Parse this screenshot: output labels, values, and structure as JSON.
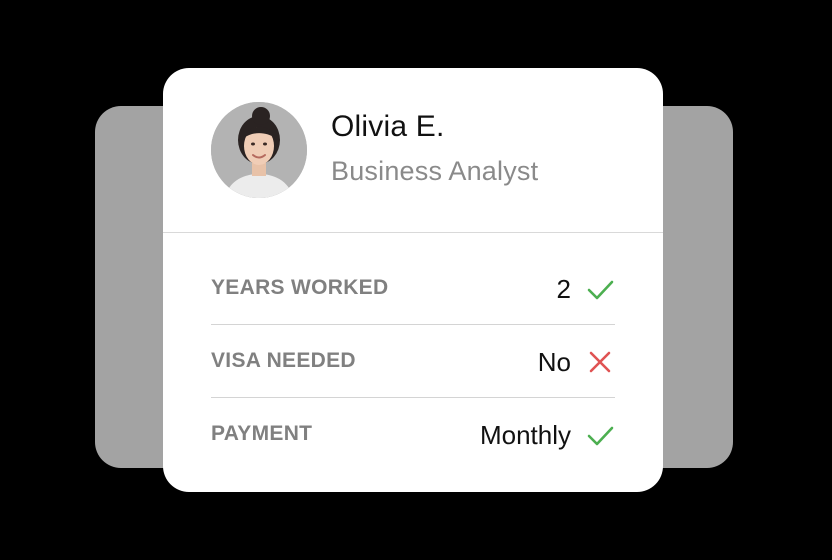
{
  "profile": {
    "name": "Olivia E.",
    "role": "Business Analyst"
  },
  "details": [
    {
      "label": "YEARS WORKED",
      "value": "2",
      "status": "check-icon"
    },
    {
      "label": "VISA NEEDED",
      "value": "No",
      "status": "cross-icon"
    },
    {
      "label": "PAYMENT",
      "value": "Monthly",
      "status": "check-icon"
    }
  ],
  "colors": {
    "background": "#000000",
    "back_card": "#a3a3a3",
    "card": "#ffffff",
    "check": "#4caf50",
    "cross": "#e05353"
  }
}
